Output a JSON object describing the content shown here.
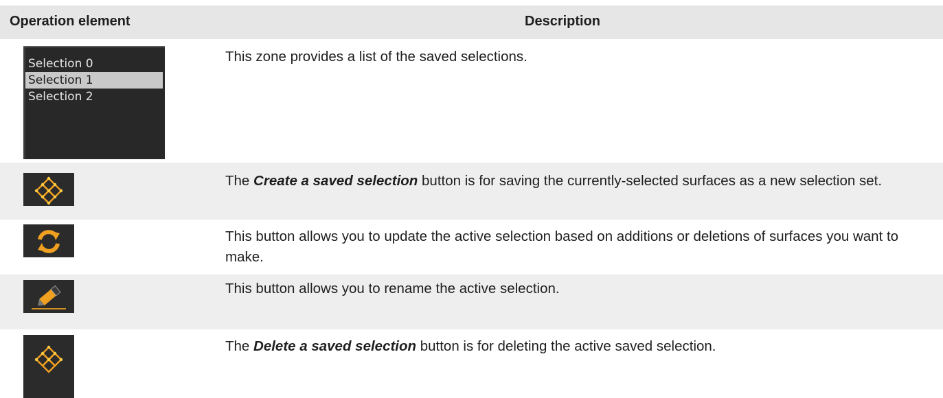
{
  "header": {
    "col_element": "Operation element",
    "col_description": "Description"
  },
  "selection_list": {
    "items": [
      "Selection 0",
      "Selection 1",
      "Selection 2"
    ],
    "selected_index": 1
  },
  "rows": [
    {
      "description": "This zone provides a list of the saved selections."
    },
    {
      "icon": "create-saved-selection-icon",
      "prefix": "The ",
      "bold": "Create a saved selection",
      "suffix": " button is for saving the currently-selected surfaces as a new selection set."
    },
    {
      "icon": "update-selection-icon",
      "description": "This button allows you to update the active selection based on additions or deletions of surfaces you want to make."
    },
    {
      "icon": "rename-selection-icon",
      "description": "This button allows you to rename the active selection."
    },
    {
      "icon": "delete-saved-selection-icon",
      "prefix": "The ",
      "bold": "Delete a saved selection",
      "suffix": " button is for deleting the active saved selection."
    }
  ],
  "colors": {
    "header_bg": "#e6e6e6",
    "row_shade": "#eeeeee",
    "icon_bg": "#2b2b2b",
    "icon_accent": "#f0a020"
  }
}
